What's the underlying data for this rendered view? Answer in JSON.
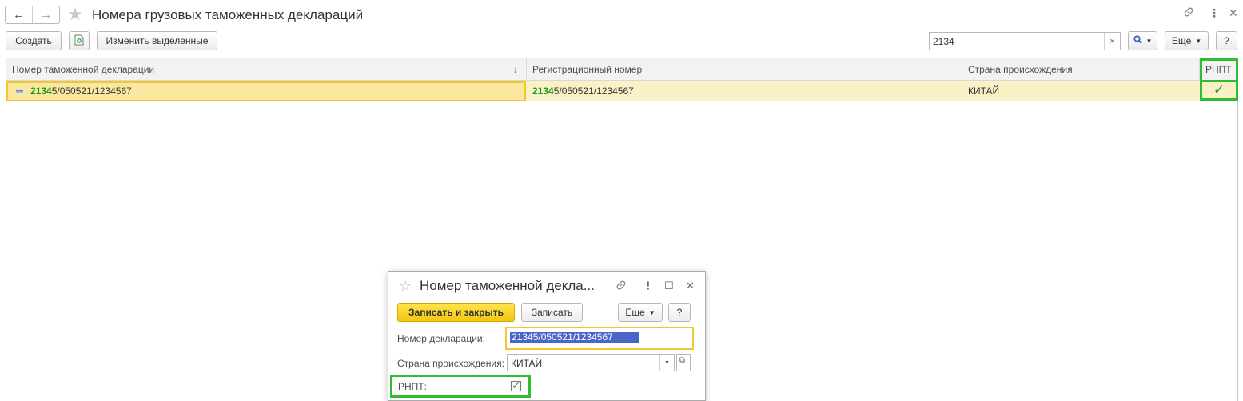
{
  "window": {
    "title": "Номера грузовых таможенных деклараций"
  },
  "toolbar": {
    "create_label": "Создать",
    "edit_selected_label": "Изменить выделенные",
    "search_value": "2134",
    "search_clear": "×",
    "more_label": "Еще",
    "help_label": "?"
  },
  "table": {
    "columns": [
      "Номер таможенной декларации",
      "Регистрационный номер",
      "Страна происхождения",
      "РНПТ"
    ],
    "sort_indicator": "↓",
    "rows": [
      {
        "number_match": "2134",
        "number_rest": "5/050521/1234567",
        "reg_match": "2134",
        "reg_rest": "5/050521/1234567",
        "country": "КИТАЙ",
        "rnpt_checked": true
      }
    ],
    "search_highlight_color": "#1a9a1a"
  },
  "dialog": {
    "title": "Номер таможенной декла...",
    "save_close_label": "Записать и закрыть",
    "save_label": "Записать",
    "more_label": "Еще",
    "help_label": "?",
    "declaration_label": "Номер декларации:",
    "declaration_value": "21345/050521/1234567",
    "country_label": "Страна происхождения:",
    "country_value": "КИТАЙ",
    "rnpt_label": "РНПТ:",
    "rnpt_checked": true
  },
  "colors": {
    "accent_yellow": "#f2c60f",
    "row_selected": "#fbf1c6",
    "green_frame": "#2fbd2f",
    "text_selection": "#4a66c9"
  }
}
